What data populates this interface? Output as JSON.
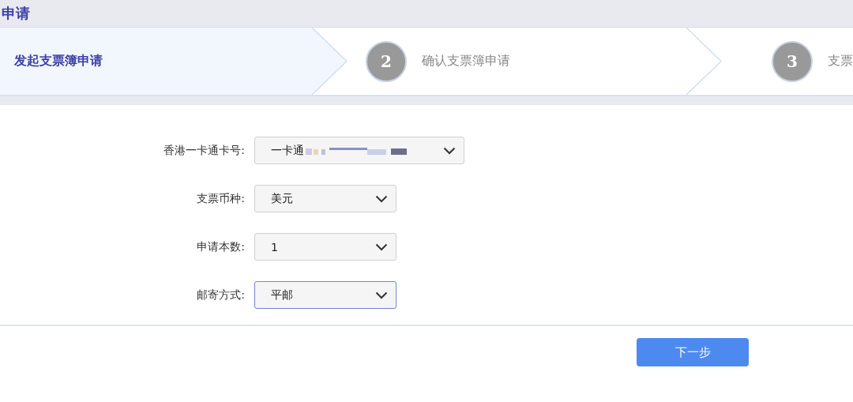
{
  "page_title": "申请",
  "steps": [
    {
      "label": "发起支票簿申请",
      "selected": true
    },
    {
      "number": "2",
      "label": "确认支票簿申请",
      "selected": false
    },
    {
      "number": "3",
      "label": "支票",
      "selected": false
    }
  ],
  "form": [
    {
      "label": "香港一卡通卡号:",
      "value": "一卡通",
      "redacted": true,
      "focused": false,
      "wide": true
    },
    {
      "label": "支票币种:",
      "value": "美元",
      "redacted": false,
      "focused": false,
      "wide": false
    },
    {
      "label": "申请本数:",
      "value": "1",
      "redacted": false,
      "focused": false,
      "wide": false
    },
    {
      "label": "邮寄方式:",
      "value": "平邮",
      "redacted": false,
      "focused": true,
      "wide": false
    }
  ],
  "next_button": "下一步"
}
